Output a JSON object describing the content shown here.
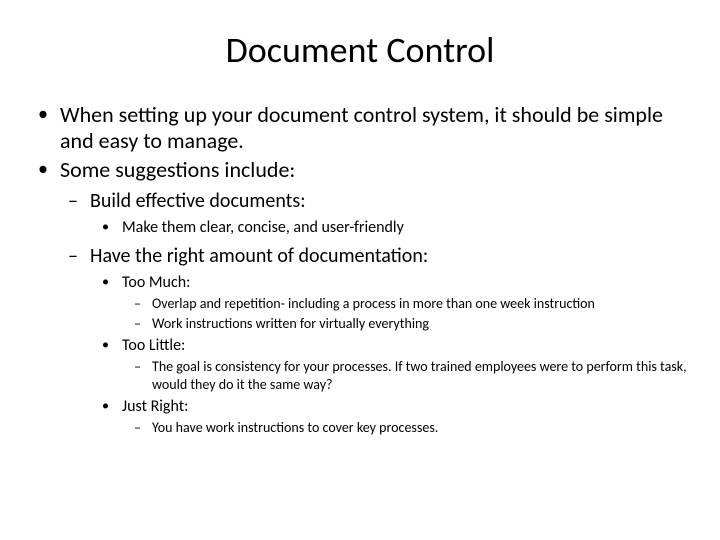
{
  "title": "Document Control",
  "bullets": {
    "p1": "When setting up your document control system, it should be simple and easy to manage.",
    "p2": "Some suggestions include:",
    "s1": "Build effective documents:",
    "s1a": "Make them clear, concise, and user-friendly",
    "s2": "Have the right amount of documentation:",
    "s2a": "Too Much:",
    "s2a1": "Overlap and repetition- including a process in more than one week instruction",
    "s2a2": "Work instructions written for virtually everything",
    "s2b": "Too Little:",
    "s2b1": "The goal is consistency for your processes. If two trained employees were to perform this task, would they do it the same way?",
    "s2c": "Just Right:",
    "s2c1": "You have work instructions to cover key processes."
  }
}
